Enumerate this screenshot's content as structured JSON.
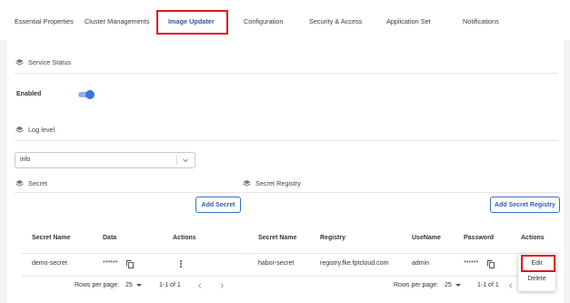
{
  "tabs": [
    {
      "label": "Essential Properties"
    },
    {
      "label": "Cluster Managements"
    },
    {
      "label": "Image Updater"
    },
    {
      "label": "Configuration"
    },
    {
      "label": "Security & Access"
    },
    {
      "label": "Application Set"
    },
    {
      "label": "Notifications"
    }
  ],
  "active_tab": "Image Updater",
  "service_status": {
    "title": "Service Status",
    "enabled_label": "Enabled",
    "enabled": true
  },
  "log_level": {
    "title": "Log level",
    "value": "info"
  },
  "secret": {
    "title": "Secret",
    "add_button": "Add Secret",
    "columns": [
      "Secret Name",
      "Data",
      "Actions"
    ],
    "rows": [
      {
        "name": "demo-secret",
        "data": "******"
      }
    ],
    "pagination": {
      "rows_per_page_label": "Rows per page:",
      "rows_per_page": "25",
      "range": "1-1 of 1"
    }
  },
  "secret_registry": {
    "title": "Secret Registry",
    "add_button": "Add Secret Registry",
    "columns": [
      "Secret Name",
      "Registry",
      "UseName",
      "Password",
      "Actions"
    ],
    "rows": [
      {
        "name": "habor-secret",
        "registry": "registry.fke.fptcloud.com",
        "username": "admin",
        "password": "******"
      }
    ],
    "pagination": {
      "rows_per_page_label": "Rows per page:",
      "rows_per_page": "25",
      "range": "1-1 of 1"
    }
  },
  "action_menu": {
    "edit": "Edit",
    "delete": "Delete"
  },
  "colors": {
    "accent": "#2f56a6",
    "toggle": "#3c74d8",
    "highlight": "#e0141e"
  }
}
